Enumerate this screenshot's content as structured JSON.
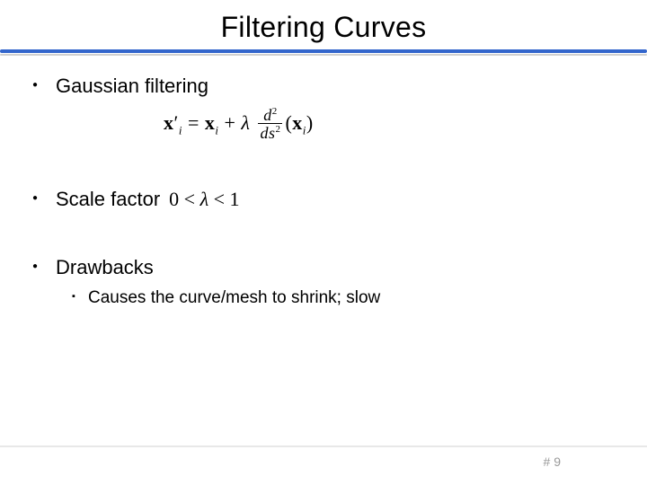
{
  "title": "Filtering Curves",
  "bullets": {
    "b1": {
      "label": "Gaussian filtering"
    },
    "b2": {
      "label": "Scale factor",
      "constraint_lhs": "0 < ",
      "constraint_sym": "λ",
      "constraint_rhs": " < 1"
    },
    "b3": {
      "label": "Drawbacks",
      "sub1": "Causes the curve/mesh to shrink; slow"
    }
  },
  "formula": {
    "x": "x",
    "prime": "′",
    "i": "i",
    "eq": " = ",
    "plus": " + ",
    "lambda": "λ",
    "d2": "d",
    "sup2": "2",
    "ds2_d": "d",
    "ds2_s": "s",
    "lparen": "(",
    "rparen": ")"
  },
  "page": {
    "hash": "#",
    "num": "9"
  }
}
